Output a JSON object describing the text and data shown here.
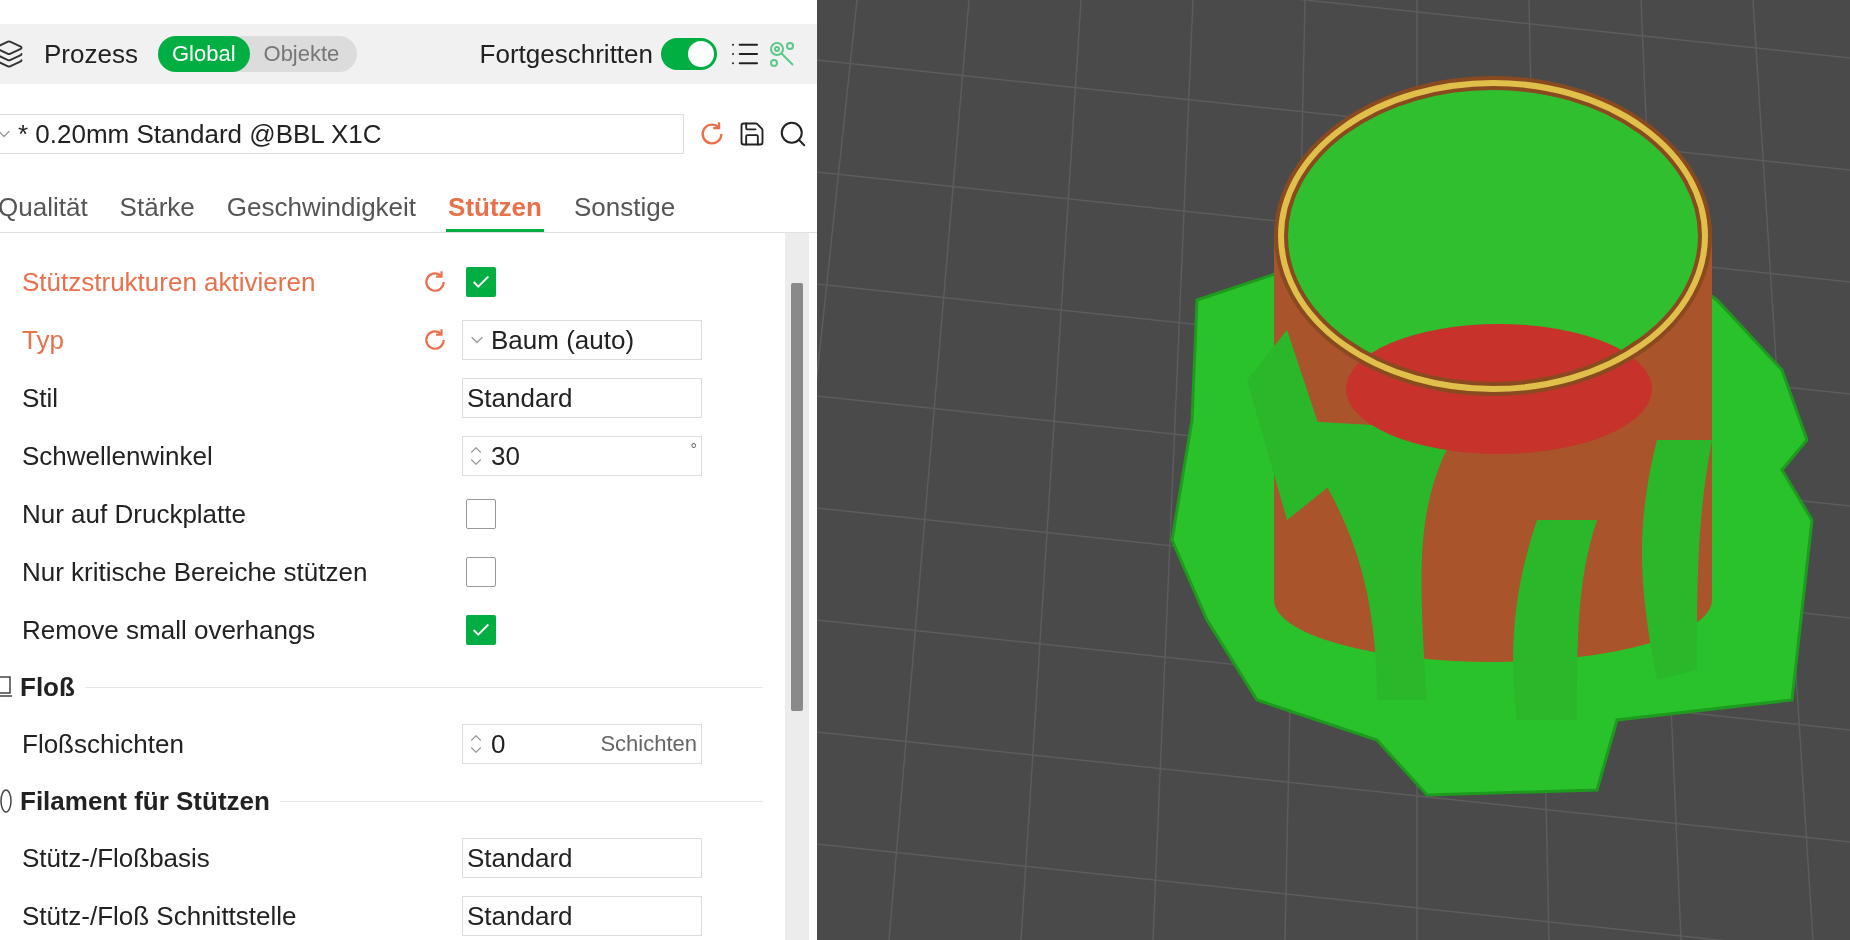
{
  "header": {
    "title": "Prozess",
    "scope_tabs": [
      {
        "label": "Global",
        "selected": true
      },
      {
        "label": "Objekte",
        "selected": false
      }
    ],
    "advanced": {
      "label": "Fortgeschritten",
      "on": true
    }
  },
  "preset": {
    "value": "* 0.20mm Standard @BBL X1C"
  },
  "tabs": [
    {
      "label": "Qualität",
      "selected": false
    },
    {
      "label": "Stärke",
      "selected": false
    },
    {
      "label": "Geschwindigkeit",
      "selected": false
    },
    {
      "label": "Stützen",
      "selected": true
    },
    {
      "label": "Sonstige",
      "selected": false
    }
  ],
  "settings": [
    {
      "kind": "checkbox",
      "label": "Stützstrukturen aktivieren",
      "changed": true,
      "checked": true
    },
    {
      "kind": "dropdown",
      "label": "Typ",
      "changed": true,
      "value": "Baum (auto)"
    },
    {
      "kind": "select",
      "label": "Stil",
      "changed": false,
      "value": "Standard"
    },
    {
      "kind": "spinner",
      "label": "Schwellenwinkel",
      "changed": false,
      "value": "30",
      "unit": "°"
    },
    {
      "kind": "checkbox",
      "label": "Nur auf Druckplatte",
      "changed": false,
      "checked": false
    },
    {
      "kind": "checkbox",
      "label": "Nur kritische Bereiche stützen",
      "changed": false,
      "checked": false
    },
    {
      "kind": "checkbox",
      "label": "Remove small overhangs",
      "changed": false,
      "checked": true
    },
    {
      "kind": "section",
      "label": "Floß"
    },
    {
      "kind": "spinner",
      "label": "Floßschichten",
      "changed": false,
      "value": "0",
      "unit": "Schichten"
    },
    {
      "kind": "section",
      "label": "Filament für Stützen"
    },
    {
      "kind": "select",
      "label": "Stütz-/Floßbasis",
      "changed": false,
      "value": "Standard"
    },
    {
      "kind": "select",
      "label": "Stütz-/Floß Schnittstelle",
      "changed": false,
      "value": "Standard"
    }
  ]
}
